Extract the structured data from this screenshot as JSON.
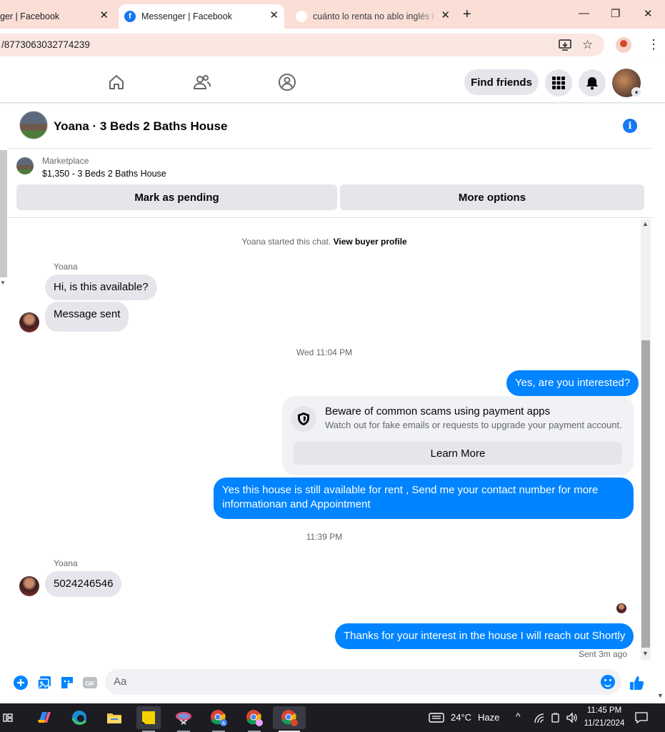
{
  "browser": {
    "tabs": [
      {
        "title": "ger | Facebook",
        "active": false
      },
      {
        "title": "Messenger | Facebook",
        "active": true
      },
      {
        "title": "cuánto lo renta no ablo inglés i",
        "active": false
      }
    ],
    "close_glyph": "✕",
    "new_tab_glyph": "+",
    "url": "/8773063032774239",
    "window_controls": [
      "—",
      "❐",
      "✕"
    ]
  },
  "fb_header": {
    "find_friends_label": "Find friends",
    "icons": [
      "home-icon",
      "friends-icon",
      "groups-icon",
      "menu-grid-icon",
      "notifications-bell-icon"
    ]
  },
  "chat": {
    "title": "Yoana · 3 Beds 2 Baths House",
    "marketplace_label": "Marketplace",
    "listing": "$1,350 - 3 Beds 2 Baths House",
    "mark_pending_label": "Mark as pending",
    "more_options_label": "More options",
    "started_text": "Yoana started this chat.",
    "view_buyer_profile": "View buyer profile",
    "messages": {
      "sender_name_1": "Yoana",
      "m1": "Hi, is this available?",
      "m2": "Message sent",
      "time_1": "Wed 11:04 PM",
      "m3": "Yes, are you interested?",
      "warning_title": "Beware of common scams using payment apps",
      "warning_sub": "Watch out for fake emails or requests to upgrade your payment account.",
      "learn_more_label": "Learn More",
      "m4": "Yes this house is still available for rent , Send me your contact number for more informationan and Appointment",
      "time_2": "11:39 PM",
      "sender_name_2": "Yoana",
      "m5": "5024246546",
      "m6": "Thanks for your interest in the house I will reach out Shortly",
      "sent_status": "Sent 3m ago"
    },
    "composer_placeholder": "Aa"
  },
  "taskbar": {
    "weather_temp": "24°C",
    "weather_desc": "Haze",
    "time": "11:45 PM",
    "date": "11/21/2024"
  },
  "colors": {
    "messenger_blue": "#0084ff",
    "facebook_blue": "#1877f2",
    "tab_strip": "#fbded6"
  }
}
